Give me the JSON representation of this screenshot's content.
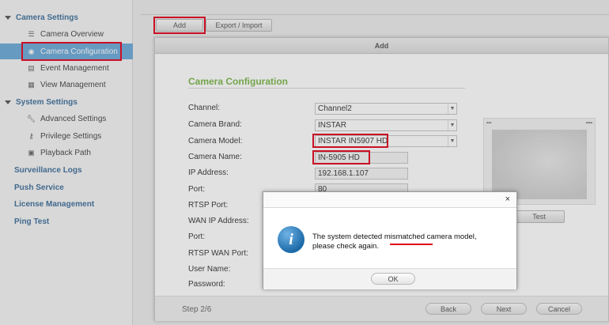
{
  "sidebar": {
    "camera_settings": "Camera Settings",
    "items_camera": [
      {
        "label": "Camera Overview",
        "icon": "list-icon"
      },
      {
        "label": "Camera Configuration",
        "icon": "camera-icon"
      },
      {
        "label": "Event Management",
        "icon": "event-icon"
      },
      {
        "label": "View Management",
        "icon": "grid-icon"
      }
    ],
    "system_settings": "System Settings",
    "items_system": [
      {
        "label": "Advanced Settings",
        "icon": "wrench-icon"
      },
      {
        "label": "Privilege Settings",
        "icon": "key-icon"
      },
      {
        "label": "Playback Path",
        "icon": "folder-icon"
      }
    ],
    "surveillance_logs": "Surveillance Logs",
    "push_service": "Push Service",
    "license_management": "License Management",
    "ping_test": "Ping Test"
  },
  "toolbar": {
    "add_label": "Add",
    "export_label": "Export / Import"
  },
  "dialog": {
    "title": "Add",
    "section_title": "Camera Configuration",
    "labels": {
      "channel": "Channel:",
      "brand": "Camera Brand:",
      "model": "Camera Model:",
      "name": "Camera Name:",
      "ip": "IP Address:",
      "port": "Port:",
      "rtsp_port": "RTSP Port:",
      "wan_ip": "WAN IP Address:",
      "port2": "Port:",
      "rtsp_wan_port": "RTSP WAN Port:",
      "user": "User Name:",
      "password": "Password:"
    },
    "values": {
      "channel": "Channel2",
      "brand": "INSTAR",
      "model": "INSTAR IN5907 HD",
      "name": "IN-5905 HD",
      "ip": "192.168.1.107",
      "port": "80"
    },
    "test_label": "Test",
    "step": "Step 2/6",
    "back_label": "Back",
    "next_label": "Next",
    "cancel_label": "Cancel"
  },
  "alert": {
    "close": "×",
    "text_before": "The system detected ",
    "text_highlight": "mismatched",
    "text_after": " camera model,",
    "text_line2": "please check again.",
    "ok_label": "OK"
  },
  "colors": {
    "highlight_red": "#e2001a",
    "active_blue": "#6aa9d8",
    "section_green": "#7ab648"
  }
}
